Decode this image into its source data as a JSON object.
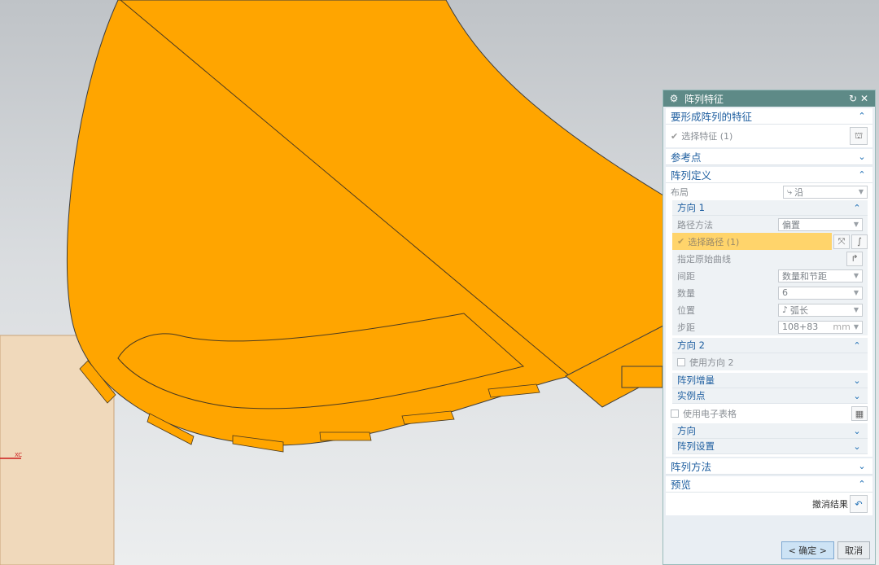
{
  "dialog": {
    "title": "阵列特征",
    "sections": {
      "features": {
        "title": "要形成阵列的特征",
        "select_label": "选择特征 (1)"
      },
      "reference_point": {
        "title": "参考点"
      },
      "definition": {
        "title": "阵列定义",
        "layout_label": "布局",
        "layout_value": "沿",
        "direction1": {
          "title": "方向 1",
          "path_method_label": "路径方法",
          "path_method_value": "偏置",
          "select_path_label": "选择路径 (1)",
          "specify_curve_label": "指定原始曲线",
          "spacing_label": "间距",
          "spacing_value": "数量和节距",
          "count_label": "数量",
          "count_value": "6",
          "position_label": "位置",
          "position_value": "弧长",
          "pitch_label": "步距",
          "pitch_value": "108+83",
          "pitch_unit": "mm"
        },
        "direction2": {
          "title": "方向 2",
          "use_label": "使用方向 2"
        },
        "increment": {
          "title": "阵列增量"
        },
        "instance": {
          "title": "实例点"
        },
        "spreadsheet_label": "使用电子表格",
        "orientation": {
          "title": "方向"
        },
        "settings": {
          "title": "阵列设置"
        }
      },
      "method": {
        "title": "阵列方法"
      },
      "preview": {
        "title": "预览",
        "undo_label": "撤消结果"
      }
    },
    "ok_label": "< 确定 >",
    "cancel_label": "取消"
  },
  "viewport": {
    "axis_label": "XC",
    "part_color": "#ffa500",
    "background_color": "#d9dcdf"
  }
}
